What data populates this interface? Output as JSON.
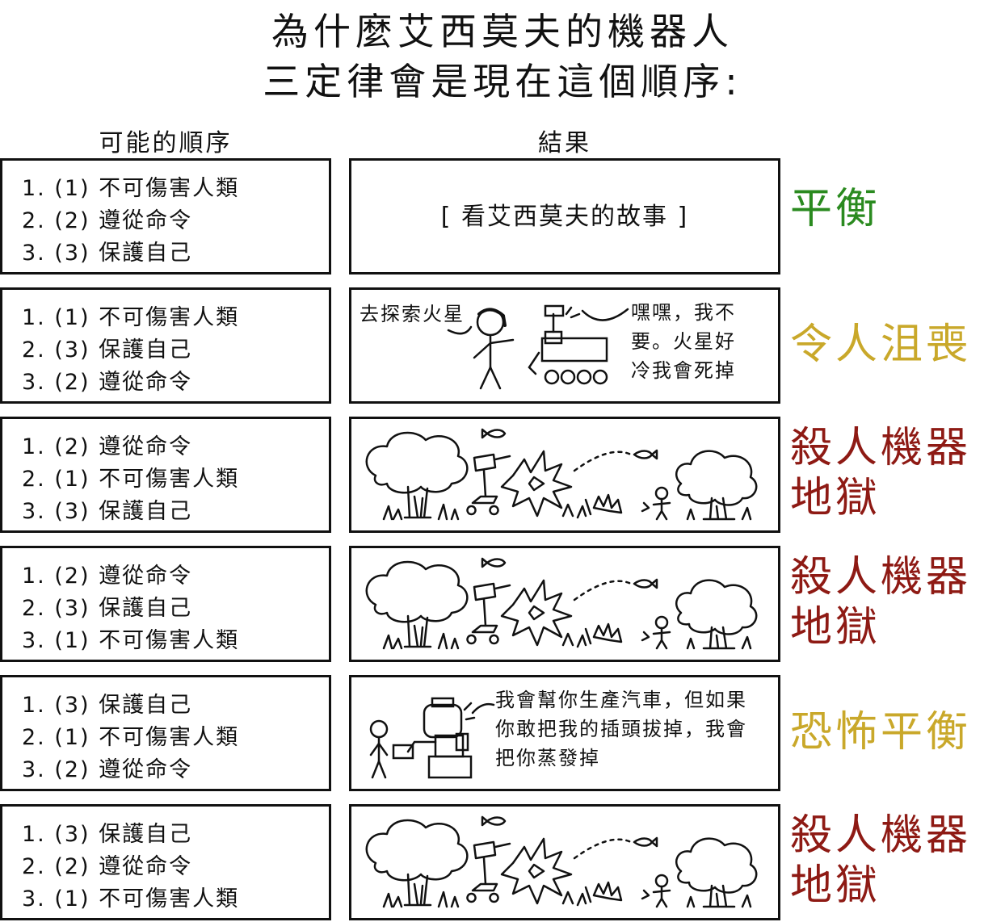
{
  "title": {
    "line1": "為什麼艾西莫夫的機器人",
    "line2": "三定律會是現在這個順序:"
  },
  "headers": {
    "orders": "可能的順序",
    "results": "結果"
  },
  "colors": {
    "green": "#2a8a1f",
    "yellow": "#c9a82a",
    "red": "#8e1a14"
  },
  "rows": [
    {
      "orders": [
        "1. (1) 不可傷害人類",
        "2. (2) 遵從命令",
        "3. (3) 保護自己"
      ],
      "result_text": "[ 看艾西莫夫的故事 ]",
      "verdict": "平衡",
      "verdict_color": "green"
    },
    {
      "orders": [
        "1. (1) 不可傷害人類",
        "2. (3) 保護自己",
        "3. (2) 遵從命令"
      ],
      "speech_human": "去探索火星",
      "speech_robot": [
        "嘿嘿，我不",
        "要。火星好",
        "冷我會死掉"
      ],
      "verdict": "令人沮喪",
      "verdict_color": "yellow"
    },
    {
      "orders": [
        "1. (2) 遵從命令",
        "2. (1) 不可傷害人類",
        "3. (3) 保護自己"
      ],
      "verdict": [
        "殺人機器",
        "地獄"
      ],
      "verdict_color": "red"
    },
    {
      "orders": [
        "1. (2) 遵從命令",
        "2. (3) 保護自己",
        "3. (1) 不可傷害人類"
      ],
      "verdict": [
        "殺人機器",
        "地獄"
      ],
      "verdict_color": "red"
    },
    {
      "orders": [
        "1. (3) 保護自己",
        "2. (1) 不可傷害人類",
        "3. (2) 遵從命令"
      ],
      "speech_robot": [
        "我會幫你生產汽車，但如果",
        "你敢把我的插頭拔掉，我會",
        "把你蒸發掉"
      ],
      "verdict": "恐怖平衡",
      "verdict_color": "yellow"
    },
    {
      "orders": [
        "1. (3) 保護自己",
        "2. (2) 遵從命令",
        "3. (1) 不可傷害人類"
      ],
      "verdict": [
        "殺人機器",
        "地獄"
      ],
      "verdict_color": "red"
    }
  ]
}
